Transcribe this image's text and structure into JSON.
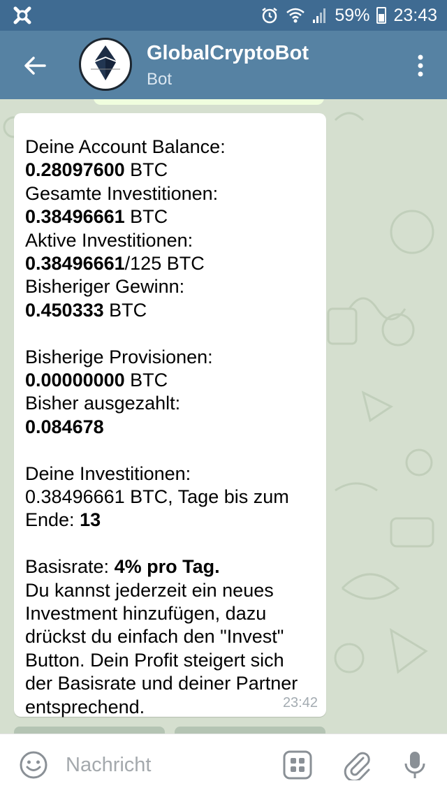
{
  "status_bar": {
    "battery": "59%",
    "time": "23:43"
  },
  "header": {
    "title": "GlobalCryptoBot",
    "subtitle": "Bot"
  },
  "message": {
    "lines": {
      "l1": "Deine Account Balance:",
      "l2_bold": "0.28097600",
      "l2_rest": " BTC",
      "l3": "Gesamte Investitionen:",
      "l4_bold": "0.38496661",
      "l4_rest": " BTC",
      "l5": "Aktive Investitionen:",
      "l6_bold": "0.38496661",
      "l6_rest": "/125 BTC",
      "l7": "Bisheriger Gewinn:",
      "l8_bold": "0.450333",
      "l8_rest": " BTC",
      "l9": "Bisherige Provisionen:",
      "l10_bold": "0.00000000",
      "l10_rest": " BTC",
      "l11": "Bisher ausgezahlt:",
      "l12_bold": "0.084678",
      "l13": "Deine Investitionen:",
      "l14": "0.38496661 BTC, Tage bis zum",
      "l15_pre": "Ende: ",
      "l15_bold": "13",
      "l16_pre": "Basisrate: ",
      "l16_bold": "4% pro Tag.",
      "l17": "Du kannst jederzeit ein neues",
      "l18": "Investment hinzufügen, dazu",
      "l19": "drückst du einfach den \"Invest\"",
      "l20": "Button. Dein Profit steigert sich",
      "l21": "der Basisrate und deiner Partner",
      "l22": "entsprechend."
    },
    "time": "23:42"
  },
  "input": {
    "placeholder": "Nachricht"
  },
  "colors": {
    "header": "#5682a3",
    "status_bar": "#3f6b92",
    "chat_background": "#d5dfcf",
    "bubble": "#ffffff"
  },
  "icons": [
    "app-notification-icon",
    "alarm-icon",
    "wifi-icon",
    "signal-icon",
    "battery-icon",
    "back-arrow-icon",
    "more-vert-icon",
    "emoji-icon",
    "bot-keyboard-icon",
    "attach-icon",
    "mic-icon"
  ]
}
